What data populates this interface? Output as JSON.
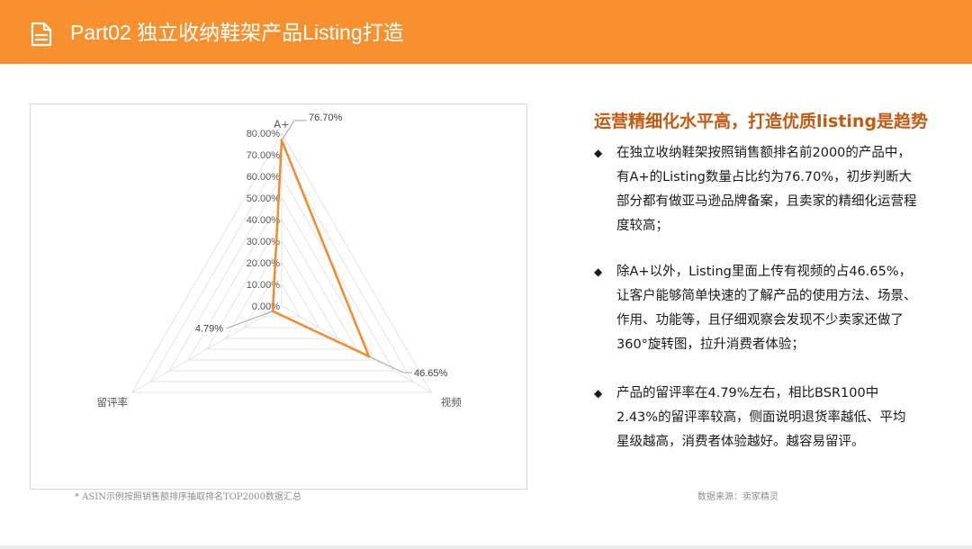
{
  "header": {
    "title": "Part02 独立收纳鞋架产品Listing打造",
    "icon": "document-icon",
    "color": "#f7912f"
  },
  "chart_data": {
    "type": "radar",
    "categories": [
      "A+",
      "视频",
      "留评率"
    ],
    "series": [
      {
        "values": [
          76.7,
          46.65,
          4.79
        ],
        "labels": [
          "76.70%",
          "46.65%",
          "4.79%"
        ],
        "color": "#f28b30"
      }
    ],
    "rlim": [
      0,
      80
    ],
    "ticks": [
      "0.00%",
      "10.00%",
      "20.00%",
      "30.00%",
      "40.00%",
      "50.00%",
      "60.00%",
      "70.00%",
      "80.00%"
    ],
    "grid": true
  },
  "chart_note": "* ASIN示例按照销售额排序抽取排名TOP2000数据汇总",
  "source": "数据来源：卖家精灵",
  "right": {
    "title": "运营精细化水平高，打造优质listing是趋势",
    "bullets": [
      {
        "mark": "◆",
        "text": "在独立收纳鞋架按照销售额排名前2000的产品中，有A+的Listing数量占比约为76.70%，初步判断大部分都有做亚马逊品牌备案，且卖家的精细化运营程度较高；"
      },
      {
        "mark": "◆",
        "text": "除A+以外，Listing里面上传有视频的占46.65%，让客户能够简单快速的了解产品的使用方法、场景、作用、功能等，且仔细观察会发现不少卖家还做了360°旋转图，拉升消费者体验；"
      },
      {
        "mark": "◆",
        "text": "产品的留评率在4.79%左右，相比BSR100中2.43%的留评率较高，侧面说明退货率越低、平均星级越高，消费者体验越好。越容易留评。"
      }
    ]
  }
}
